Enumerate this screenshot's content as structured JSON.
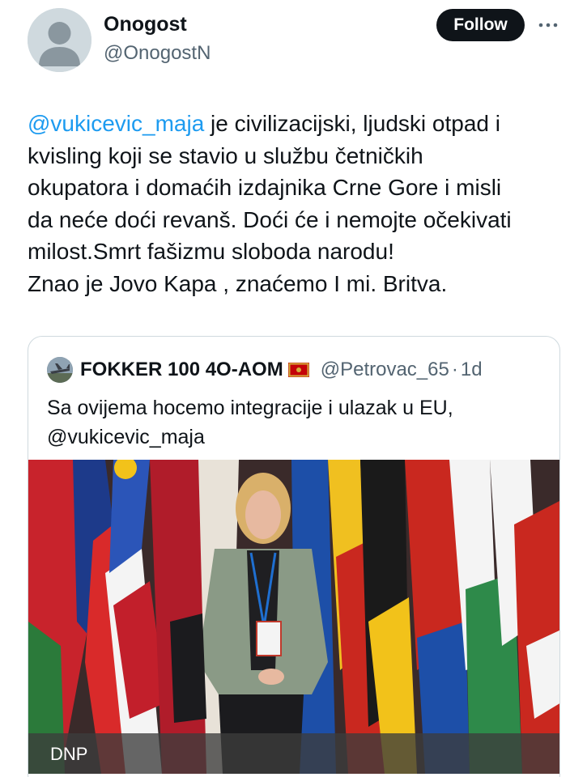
{
  "header": {
    "display_name": "Onogost",
    "handle": "@OnogostN",
    "follow_label": "Follow"
  },
  "tweet": {
    "mention": "@vukicevic_maja",
    "line1_rest": " je civilizacijski, ljudski otpad i",
    "line2": "kvisling koji se stavio u službu četničkih",
    "line3": "okupatora i domaćih izdajnika Crne Gore i misli",
    "line4": "da neće doći revanš. Doći će i nemojte očekivati",
    "line5": "milost.Smrt fašizmu sloboda narodu!",
    "line6": "Znao je Jovo Kapa , znaćemo I mi. Britva."
  },
  "quoted": {
    "display_name": "FOKKER 100 4O-AOM",
    "flag_icon": "montenegro-flag-icon",
    "handle": "@Petrovac_65",
    "separator": "·",
    "time": "1d",
    "text_line1": "Sa ovijema hocemo integracije i ulazak u EU,",
    "text_line2": "@vukicevic_maja",
    "media_label": "DNP"
  },
  "colors": {
    "mention": "#1d9bf0",
    "secondary_text": "#536471",
    "follow_bg": "#0f1419",
    "border": "#cfd9de"
  }
}
